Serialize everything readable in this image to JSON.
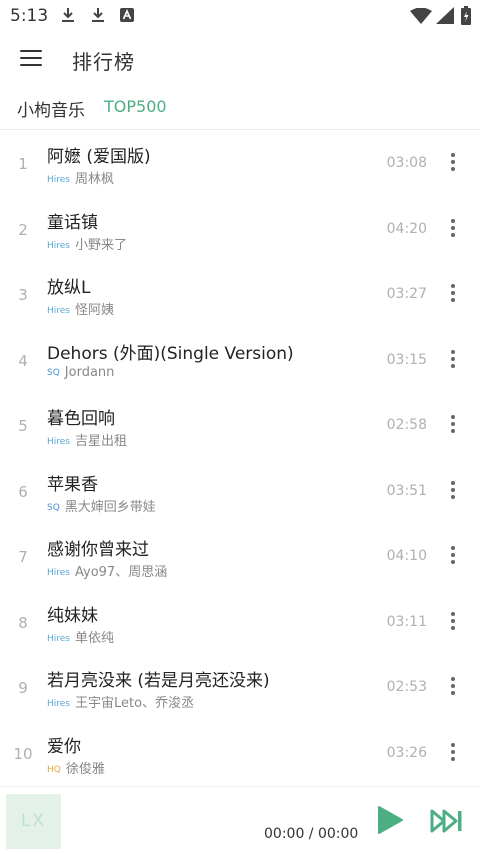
{
  "status": {
    "time": "5:13"
  },
  "app": {
    "title": "排行榜"
  },
  "source": {
    "name": "小枸音乐",
    "tab": "TOP500"
  },
  "songs": [
    {
      "num": "1",
      "name": "阿嬷 (爱国版)",
      "quality": "Hires",
      "artist": "周林枫",
      "duration": "03:08"
    },
    {
      "num": "2",
      "name": "童话镇",
      "quality": "Hires",
      "artist": "小野来了",
      "duration": "04:20"
    },
    {
      "num": "3",
      "name": "放纵L",
      "quality": "Hires",
      "artist": "怪阿姨",
      "duration": "03:27"
    },
    {
      "num": "4",
      "name": "Dehors (外面)(Single Version)",
      "quality": "SQ",
      "artist": "Jordann",
      "duration": "03:15"
    },
    {
      "num": "5",
      "name": "暮色回响",
      "quality": "Hires",
      "artist": "吉星出租",
      "duration": "02:58"
    },
    {
      "num": "6",
      "name": "苹果香",
      "quality": "SQ",
      "artist": "黑大婶回乡带娃",
      "duration": "03:51"
    },
    {
      "num": "7",
      "name": "感谢你曾来过",
      "quality": "Hires",
      "artist": "Ayo97、周思涵",
      "duration": "04:10"
    },
    {
      "num": "8",
      "name": "纯妹妹",
      "quality": "Hires",
      "artist": "单依纯",
      "duration": "03:11"
    },
    {
      "num": "9",
      "name": "若月亮没来 (若是月亮还没来)",
      "quality": "Hires",
      "artist": "王宇宙Leto、乔浚丞",
      "duration": "02:53"
    },
    {
      "num": "10",
      "name": "爱你",
      "quality": "HQ",
      "artist": "徐俊雅",
      "duration": "03:26"
    }
  ],
  "player": {
    "cover_text": "LX",
    "time": "00:00 / 00:00"
  },
  "colors": {
    "accent": "#4caf84",
    "hires": "#55a8d8",
    "sq": "#4a90d9",
    "hq": "#e0a838"
  }
}
